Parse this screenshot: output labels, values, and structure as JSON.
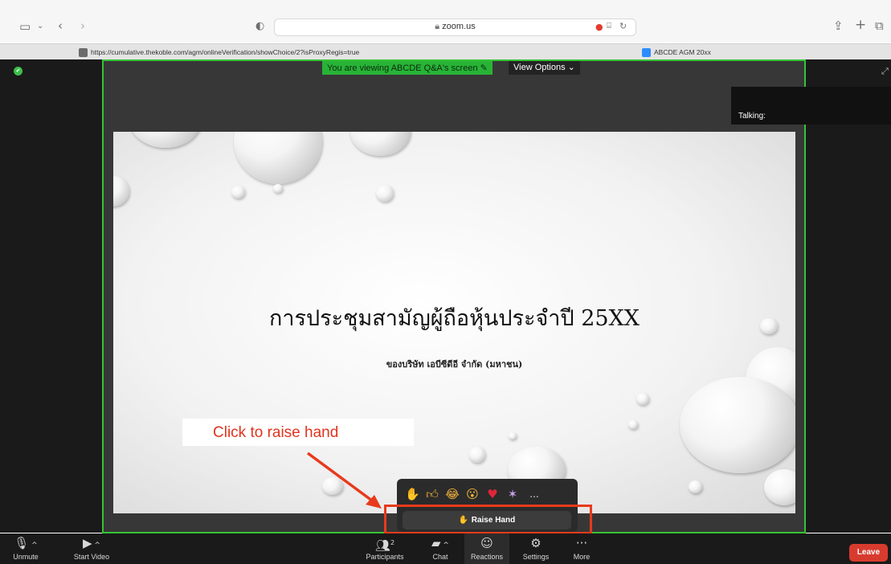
{
  "browser": {
    "address": "zoom.us",
    "tabs": [
      {
        "label": "https://cumulative.thekoble.com/agm/onlineVerification/showChoice/2?isProxyRegis=true"
      },
      {
        "label": "ABCDE AGM 20xx"
      }
    ]
  },
  "meeting": {
    "viewing_label": "You are viewing ABCDE Q&A's screen",
    "view_options_label": "View Options",
    "talking_label": "Talking:"
  },
  "slide": {
    "title": "การประชุมสามัญผู้ถือหุ้นประจำปี 25XX",
    "subtitle": "ของบริษัท เอบีซีดีอี จำกัด (มหาชน)"
  },
  "annotation": {
    "callout": "Click to raise hand",
    "accent_color": "#e83a1c"
  },
  "reactions": {
    "emojis": [
      "clap",
      "thumbs-up",
      "laughing",
      "surprised",
      "heart",
      "party"
    ],
    "more_label": "...",
    "raise_hand_label": "Raise Hand"
  },
  "controls": {
    "unmute": "Unmute",
    "start_video": "Start Video",
    "participants": "Participants",
    "participant_count": "2",
    "chat": "Chat",
    "reactions": "Reactions",
    "settings": "Settings",
    "more": "More",
    "leave": "Leave"
  }
}
